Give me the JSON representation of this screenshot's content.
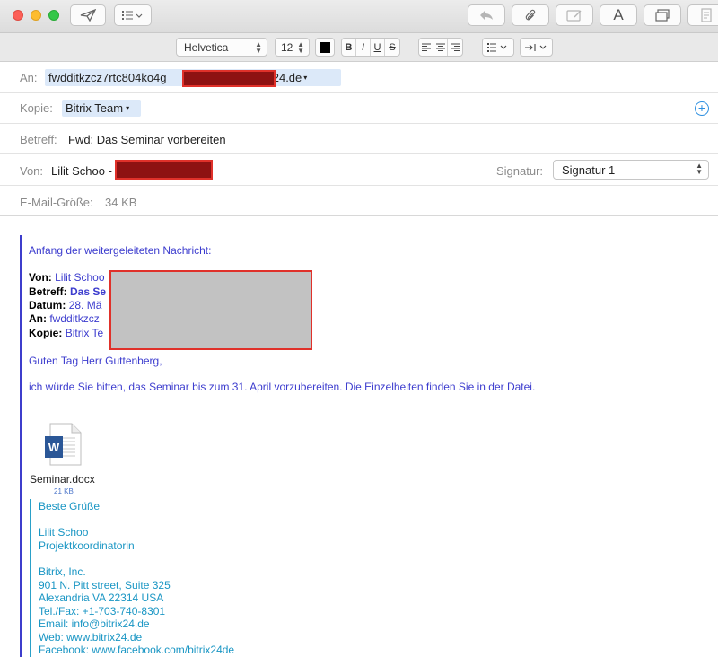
{
  "toolbar": {
    "send_icon": "paper-plane-icon",
    "list_icon": "list-format-icon",
    "reply_icon": "reply-arrow-icon",
    "attach_icon": "paperclip-icon",
    "markup_icon": "markup-icon",
    "font_button_label": "A",
    "window_icon": "window-icon",
    "note_icon": "note-icon"
  },
  "formatbar": {
    "font_family": "Helvetica",
    "font_size": "12",
    "bold": "B",
    "italic": "I",
    "underline": "U",
    "strike": "S"
  },
  "header": {
    "to_label": "An:",
    "to_value_prefix": "fwdditkzcz7rtc804ko4g",
    "to_value_suffix": "itrix24.de",
    "cc_label": "Kopie:",
    "cc_value": "Bitrix Team",
    "subject_label": "Betreff:",
    "subject_value": "Fwd: Das Seminar vorbereiten",
    "from_label": "Von:",
    "from_value": "Lilit Schoo -",
    "signature_label": "Signatur:",
    "signature_value": "Signatur 1",
    "size_label": "E-Mail-Größe:",
    "size_value": "34 KB"
  },
  "body": {
    "forward_intro": "Anfang der weitergeleiteten Nachricht:",
    "fwd_from_label": "Von:",
    "fwd_from_value": "Lilit Schoo",
    "fwd_subject_label": "Betreff:",
    "fwd_subject_value": "Das Se",
    "fwd_date_label": "Datum:",
    "fwd_date_value": "28. Mä",
    "fwd_to_label": "An:",
    "fwd_to_value": "fwdditkzcz",
    "fwd_cc_label": "Kopie:",
    "fwd_cc_value": "Bitrix Te",
    "greeting": "Guten Tag Herr Guttenberg,",
    "message": "ich würde Sie bitten, das Seminar bis zum 31. April vorzubereiten. Die Einzelheiten finden Sie in der Datei.",
    "attachment_name": "Seminar.docx",
    "attachment_size": "21 KB",
    "attachment_icon": "word-document-icon",
    "attachment_icon_letter": "W"
  },
  "signature": {
    "closing": "Beste Grüße",
    "name": "Lilit Schoo",
    "role": "Projektkoordinatorin",
    "company": "Bitrix, Inc.",
    "street": "901 N. Pitt street, Suite 325",
    "city": "Alexandria VA 22314 USA",
    "phone": "Tel./Fax: +1-703-740-8301",
    "email": "Email: info@bitrix24.de",
    "web": "Web: www.bitrix24.de",
    "facebook": "Facebook: www.facebook.com/bitrix24de"
  },
  "colors": {
    "quote_text": "#3c3cce",
    "signature_text": "#1a96c4",
    "redaction_border": "#e0312a"
  }
}
